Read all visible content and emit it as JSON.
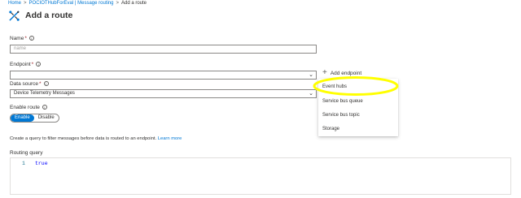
{
  "breadcrumb": [
    {
      "label": "Home"
    },
    {
      "label": "POCIOTHubForEval | Message routing"
    },
    {
      "label": "Add a route"
    }
  ],
  "separator": ">",
  "header": {
    "title": "Add a route",
    "icon": "route-icon"
  },
  "form": {
    "name": {
      "label": "Name",
      "placeholder": "name",
      "value": ""
    },
    "endpoint": {
      "label": "Endpoint",
      "value": "",
      "add_label": "Add endpoint"
    },
    "data_source": {
      "label": "Data source",
      "value": "Device Telemetry Messages"
    },
    "enable_route": {
      "label": "Enable route",
      "enable_label": "Enable",
      "disable_label": "Disable",
      "selected": "Enable"
    },
    "helper_text": "Create a query to filter messages before data is routed to an endpoint.",
    "learn_more": "Learn more",
    "routing_query": {
      "label": "Routing query",
      "line_number": "1",
      "code": "true"
    }
  },
  "dropdown": {
    "options": [
      "Event hubs",
      "Service bus queue",
      "Service bus topic",
      "Storage"
    ],
    "highlighted": "Event hubs"
  },
  "colors": {
    "accent": "#0078d4",
    "required": "#a4262c",
    "highlight": "#ffff00"
  }
}
